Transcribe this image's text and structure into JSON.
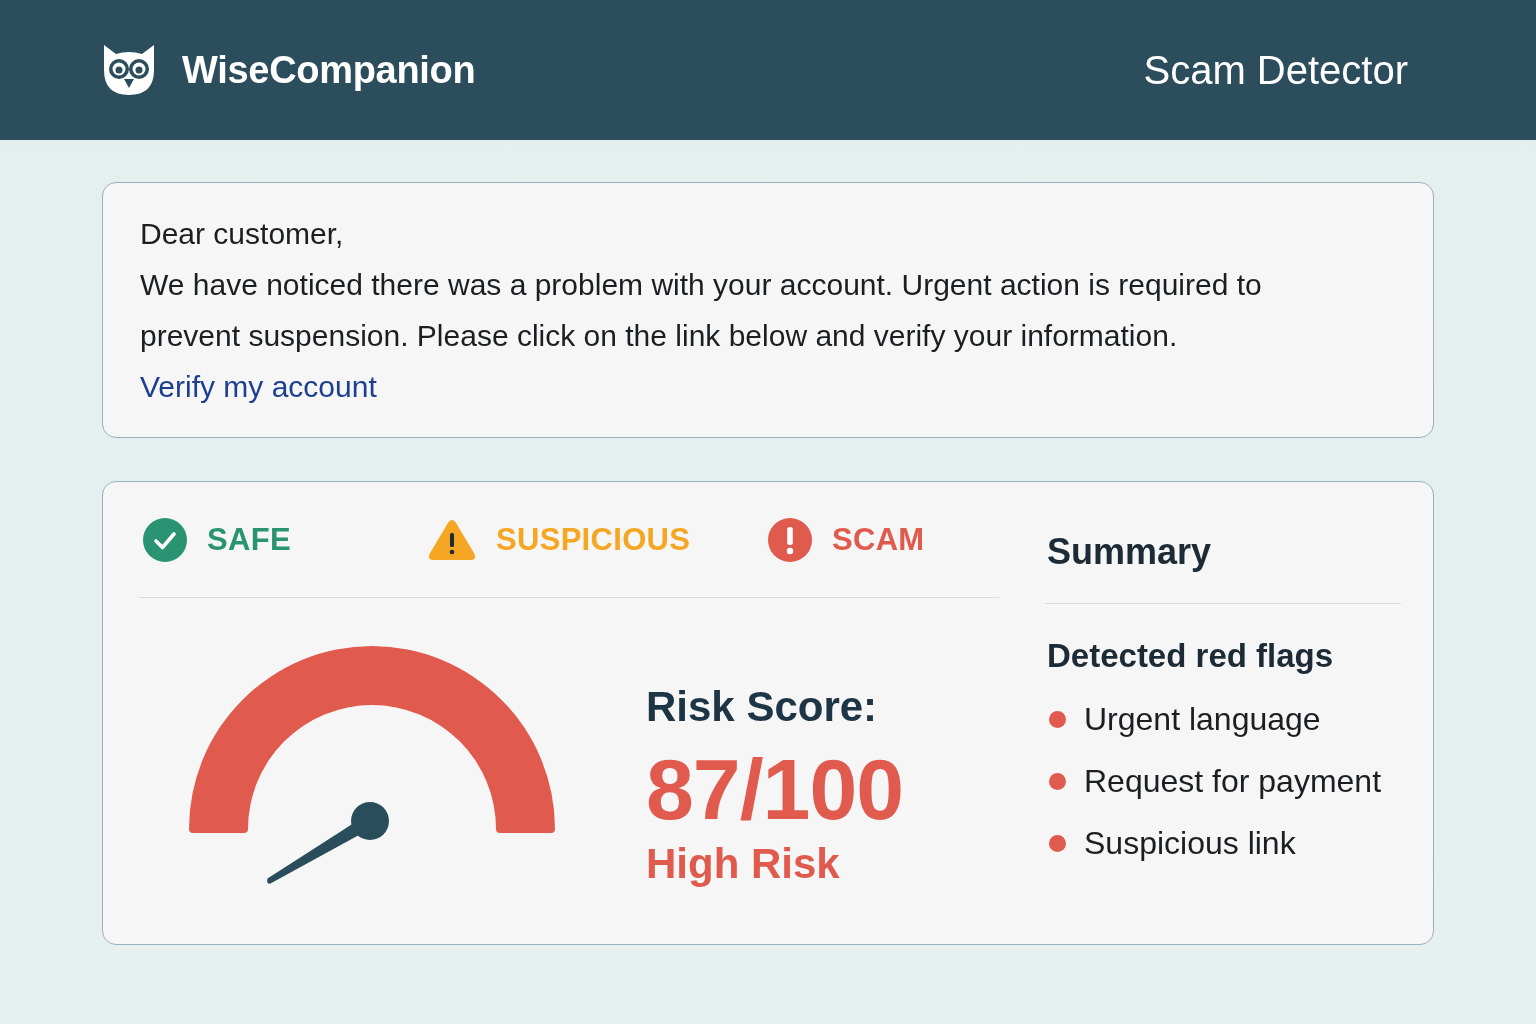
{
  "header": {
    "brand": "WiseCompanion",
    "title": "Scam Detector"
  },
  "message": {
    "greeting": "Dear customer,",
    "body": "We have noticed there was a problem with your account. Urgent action is required to prevent suspension. Please click on the link below and verify your information.",
    "link": "Verify my account"
  },
  "verdict_scale": [
    {
      "kind": "safe",
      "label": "SAFE",
      "color": "#2a9472"
    },
    {
      "kind": "suspicious",
      "label": "SUSPICIOUS",
      "color": "#f5a623"
    },
    {
      "kind": "scam",
      "label": "SCAM",
      "color": "#e05a4e"
    }
  ],
  "risk": {
    "label": "Risk Score:",
    "score": "87/100",
    "rating": "High Risk"
  },
  "summary": {
    "title": "Summary",
    "subtitle": "Detected red flags",
    "red_flags": [
      "Urgent language",
      "Request for payment",
      "Suspicious link"
    ]
  }
}
